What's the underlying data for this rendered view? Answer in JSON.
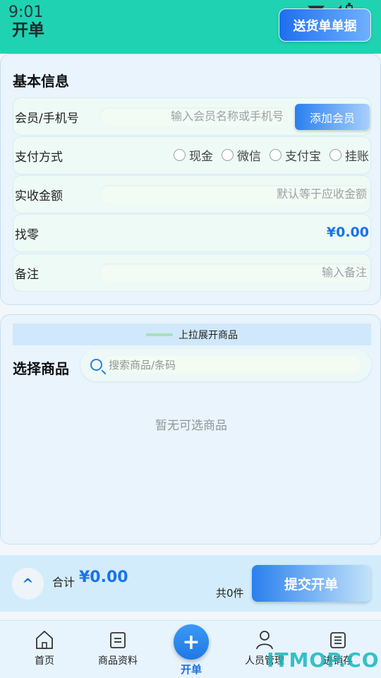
{
  "status_bar": {
    "time": "9:01"
  },
  "header": {
    "title": "开单",
    "send_button": "送货单单据"
  },
  "basic_info": {
    "title": "基本信息",
    "member": {
      "label": "会员/手机号",
      "placeholder": "输入会员名称或手机号",
      "add_button": "添加会员"
    },
    "payment": {
      "label": "支付方式",
      "options": [
        "现金",
        "微信",
        "支付宝",
        "挂账"
      ]
    },
    "received": {
      "label": "实收金额",
      "placeholder": "默认等于应收金额"
    },
    "change": {
      "label": "找零",
      "value": "¥0.00"
    },
    "remark": {
      "label": "备注",
      "placeholder": "输入备注"
    }
  },
  "goods": {
    "pull_hint": "上拉展开商品",
    "title": "选择商品",
    "search_placeholder": "搜索商品/条码",
    "empty": "暂无可选商品"
  },
  "summary": {
    "expand_icon": "^",
    "total_label": "合计",
    "total_value": "¥0.00",
    "count": "共0件",
    "submit": "提交开单"
  },
  "tabs": [
    {
      "label": "首页",
      "icon": "home-icon"
    },
    {
      "label": "商品资料",
      "icon": "document-icon"
    },
    {
      "label": "开单",
      "icon": "plus-icon"
    },
    {
      "label": "人员管理",
      "icon": "person-icon"
    },
    {
      "label": "进销存",
      "icon": "list-icon"
    }
  ],
  "watermark": "ITMOP.COM"
}
